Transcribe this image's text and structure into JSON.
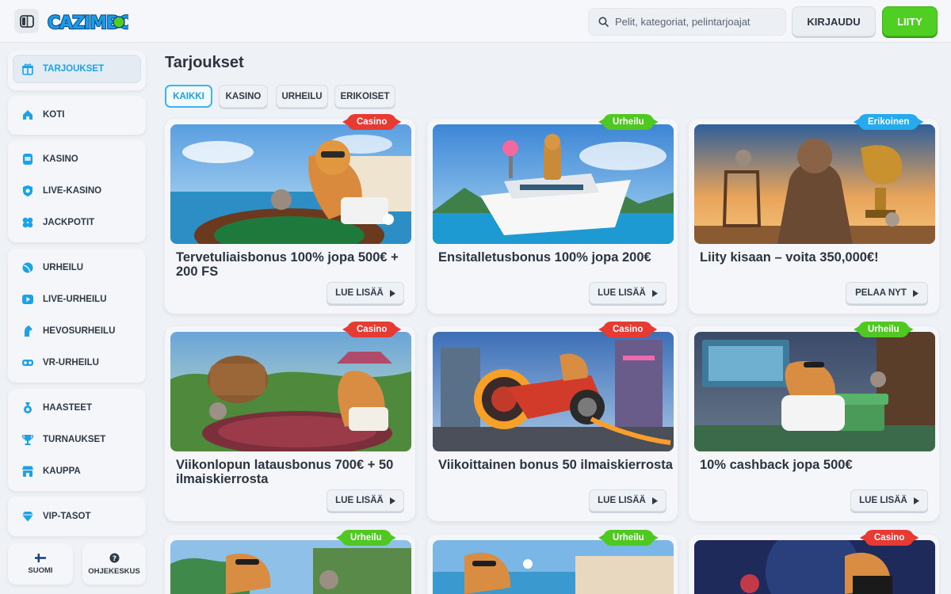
{
  "header": {
    "logo_text": "CAZIMBO",
    "search_placeholder": "Pelit, kategoriat, pelintarjoajat",
    "login_label": "KIRJAUDU",
    "join_label": "LIITY"
  },
  "sidebar": {
    "offers": "TARJOUKSET",
    "home": "KOTI",
    "casino": "KASINO",
    "live_casino": "LIVE-KASINO",
    "jackpots": "JACKPOTIT",
    "sports": "URHEILU",
    "live_sports": "LIVE-URHEILU",
    "horse_racing": "HEVOSURHEILU",
    "vr_sports": "VR-URHEILU",
    "challenges": "HAASTEET",
    "tournaments": "TURNAUKSET",
    "shop": "KAUPPA",
    "vip": "VIP-TASOT",
    "language": "SUOMI",
    "help": "OHJEKESKUS"
  },
  "main": {
    "title": "Tarjoukset",
    "tabs": [
      "KAIKKI",
      "KASINO",
      "URHEILU",
      "ERIKOISET"
    ],
    "cards": [
      {
        "tag": "Casino",
        "title": "Tervetuliaisbonus 100% jopa 500€ + 200 FS",
        "button": "LUE LISÄÄ"
      },
      {
        "tag": "Urheilu",
        "title": "Ensitalletusbonus 100% jopa 200€",
        "button": "LUE LISÄÄ"
      },
      {
        "tag": "Erikoinen",
        "title": "Liity kisaan – voita 350,000€!",
        "button": "PELAA NYT"
      },
      {
        "tag": "Casino",
        "title": "Viikonlopun latausbonus 700€ + 50 ilmaiskierrosta",
        "button": "LUE LISÄÄ"
      },
      {
        "tag": "Casino",
        "title": "Viikoittainen bonus 50 ilmaiskierrosta",
        "button": "LUE LISÄÄ"
      },
      {
        "tag": "Urheilu",
        "title": "10% cashback jopa 500€",
        "button": "LUE LISÄÄ"
      },
      {
        "tag": "Urheilu"
      },
      {
        "tag": "Urheilu"
      },
      {
        "tag": "Casino"
      }
    ]
  },
  "colors": {
    "accent_blue": "#1aa3e8",
    "join_green": "#4fcf22",
    "tag_casino": "#e63a33",
    "tag_sports": "#4fc821",
    "tag_special": "#25a9ef"
  }
}
